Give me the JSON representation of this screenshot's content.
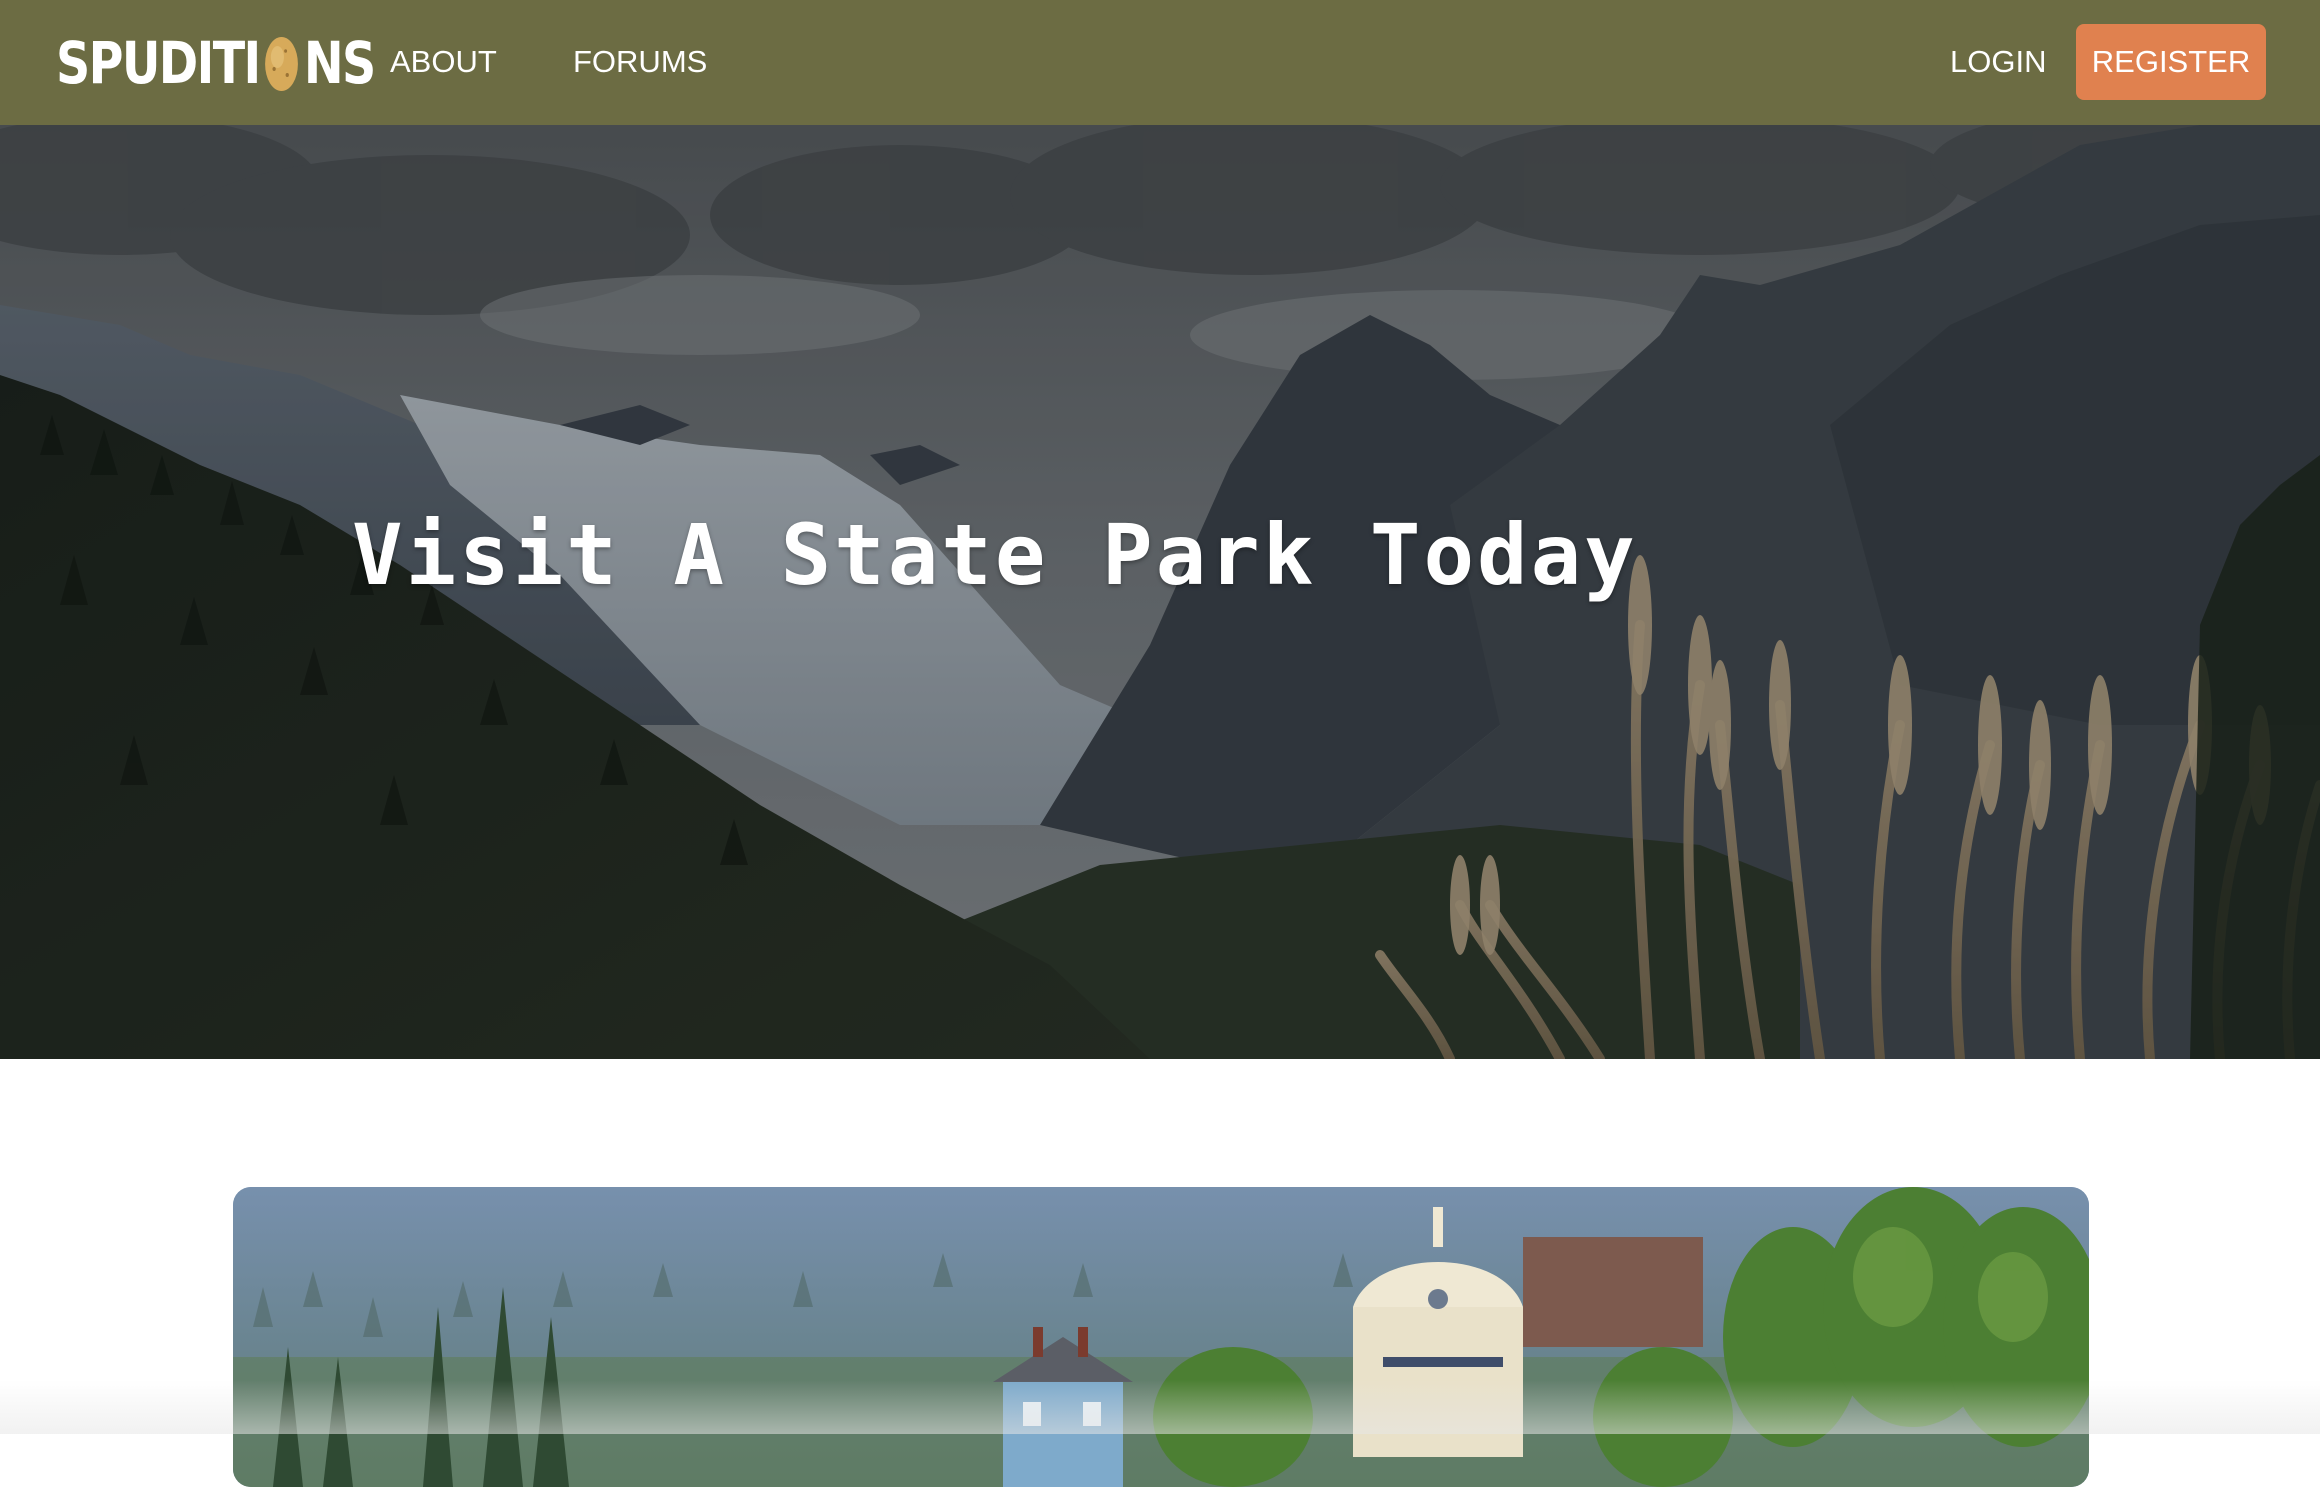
{
  "brand": {
    "name_part1": "SPUDITI",
    "name_part2": "NS",
    "logo_icon": "potato-icon",
    "accent_color": "#e0814f",
    "nav_bg": "#6c6c43"
  },
  "nav": {
    "about": "ABOUT",
    "forums": "FORUMS",
    "login": "LOGIN",
    "register": "REGISTER"
  },
  "hero": {
    "title": "Visit A State Park Today",
    "image": "mountain-valley-photo"
  },
  "featured": {
    "image": "town-with-church-photo"
  }
}
